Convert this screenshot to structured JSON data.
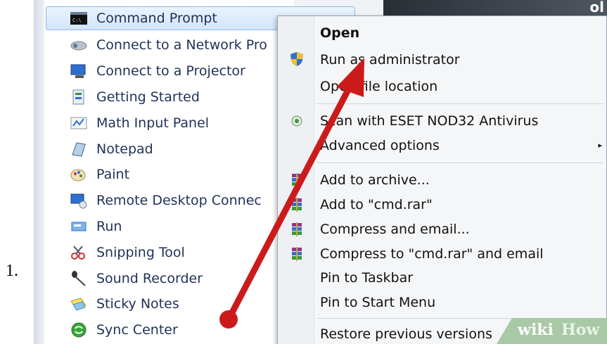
{
  "step_label": "1.",
  "corner_text": "ol",
  "programs": [
    {
      "label": "Command Prompt",
      "icon": "command-prompt-icon"
    },
    {
      "label": "Connect to a Network Pro",
      "icon": "network-projector-icon"
    },
    {
      "label": "Connect to a Projector",
      "icon": "projector-icon"
    },
    {
      "label": "Getting Started",
      "icon": "getting-started-icon"
    },
    {
      "label": "Math Input Panel",
      "icon": "math-input-icon"
    },
    {
      "label": "Notepad",
      "icon": "notepad-icon"
    },
    {
      "label": "Paint",
      "icon": "paint-icon"
    },
    {
      "label": "Remote Desktop Connec",
      "icon": "remote-desktop-icon"
    },
    {
      "label": "Run",
      "icon": "run-icon"
    },
    {
      "label": "Snipping Tool",
      "icon": "snipping-tool-icon"
    },
    {
      "label": "Sound Recorder",
      "icon": "microphone-icon"
    },
    {
      "label": "Sticky Notes",
      "icon": "sticky-notes-icon"
    },
    {
      "label": "Sync Center",
      "icon": "sync-center-icon"
    }
  ],
  "context_menu": {
    "items": [
      {
        "label": "Open",
        "bold": true
      },
      {
        "label": "Run as administrator",
        "icon": "uac-shield-icon"
      },
      {
        "label": "Open file location"
      },
      {
        "label": "Scan with ESET NOD32 Antivirus",
        "icon": "eset-icon"
      },
      {
        "label": "Advanced options",
        "submenu": "▸"
      },
      {
        "label": "Add to archive...",
        "icon": "winrar-icon"
      },
      {
        "label": "Add to \"cmd.rar\"",
        "icon": "winrar-icon"
      },
      {
        "label": "Compress and email...",
        "icon": "winrar-icon"
      },
      {
        "label": "Compress to \"cmd.rar\" and email",
        "icon": "winrar-icon"
      },
      {
        "label": "Pin to Taskbar"
      },
      {
        "label": "Pin to Start Menu"
      },
      {
        "label": "Restore previous versions"
      }
    ]
  },
  "watermark": {
    "part1": "wiki",
    "part2": "How"
  },
  "colors": {
    "arrow": "#cc1a1a",
    "menu_text": "#1e3257",
    "selection": "#d3e6fb"
  }
}
